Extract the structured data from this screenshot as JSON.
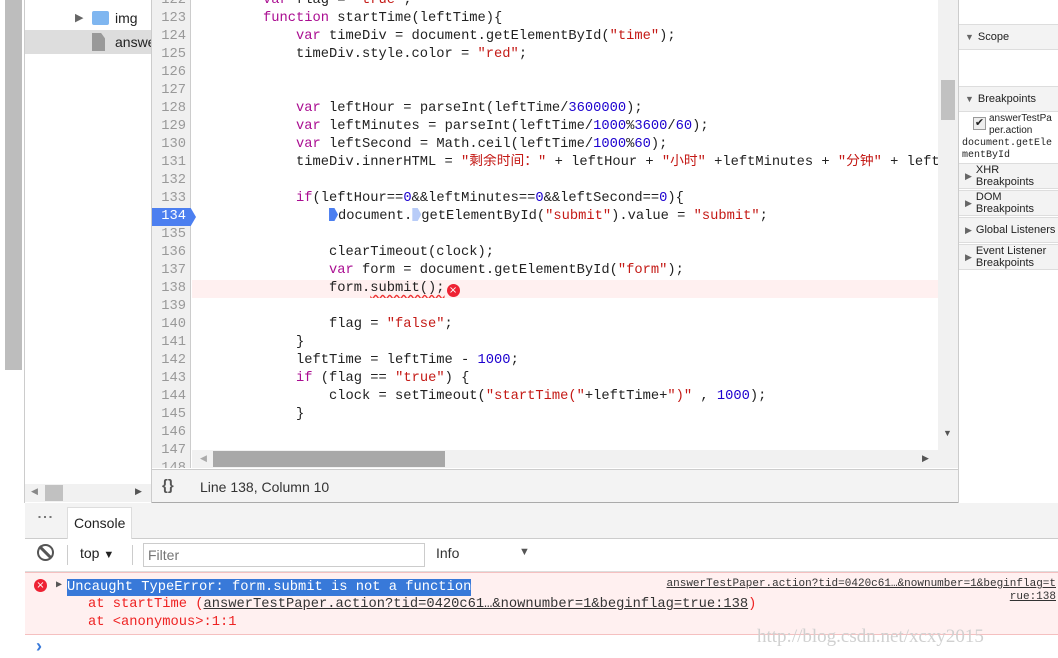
{
  "navigator": {
    "items": [
      {
        "label": "img",
        "type": "folder"
      },
      {
        "label": "answerTestPaper.action",
        "type": "file"
      }
    ]
  },
  "editor": {
    "first_line": 122,
    "breakpoint_line": 134,
    "error_line": 138,
    "lines": [
      {
        "n": 122,
        "t": [
          [
            "",
            "        "
          ],
          [
            "kw",
            "var"
          ],
          [
            "",
            " flag = "
          ],
          [
            "str",
            "\"true\""
          ],
          [
            "",
            ";"
          ]
        ]
      },
      {
        "n": 123,
        "t": [
          [
            "",
            "        "
          ],
          [
            "kw",
            "function"
          ],
          [
            "",
            " startTime(leftTime){"
          ]
        ]
      },
      {
        "n": 124,
        "t": [
          [
            "",
            "            "
          ],
          [
            "kw",
            "var"
          ],
          [
            "",
            " timeDiv = document.getElementById("
          ],
          [
            "str",
            "\"time\""
          ],
          [
            "",
            ");"
          ]
        ]
      },
      {
        "n": 125,
        "t": [
          [
            "",
            "            timeDiv.style.color = "
          ],
          [
            "str",
            "\"red\""
          ],
          [
            "",
            ";"
          ]
        ]
      },
      {
        "n": 126,
        "t": []
      },
      {
        "n": 127,
        "t": []
      },
      {
        "n": 128,
        "t": [
          [
            "",
            "            "
          ],
          [
            "kw",
            "var"
          ],
          [
            "",
            " leftHour = parseInt(leftTime/"
          ],
          [
            "num",
            "3600000"
          ],
          [
            "",
            ");"
          ]
        ]
      },
      {
        "n": 129,
        "t": [
          [
            "",
            "            "
          ],
          [
            "kw",
            "var"
          ],
          [
            "",
            " leftMinutes = parseInt(leftTime/"
          ],
          [
            "num",
            "1000"
          ],
          [
            "",
            "%"
          ],
          [
            "num",
            "3600"
          ],
          [
            "",
            "/"
          ],
          [
            "num",
            "60"
          ],
          [
            "",
            ");"
          ]
        ]
      },
      {
        "n": 130,
        "t": [
          [
            "",
            "            "
          ],
          [
            "kw",
            "var"
          ],
          [
            "",
            " leftSecond = Math.ceil(leftTime/"
          ],
          [
            "num",
            "1000"
          ],
          [
            "",
            "%"
          ],
          [
            "num",
            "60"
          ],
          [
            "",
            ");"
          ]
        ]
      },
      {
        "n": 131,
        "t": [
          [
            "",
            "            timeDiv.innerHTML = "
          ],
          [
            "str",
            "\"剩余时间：\""
          ],
          [
            "",
            " + leftHour + "
          ],
          [
            "str",
            "\"小时\""
          ],
          [
            "",
            " +leftMinutes + "
          ],
          [
            "str",
            "\"分钟\""
          ],
          [
            "",
            " + leftSecond"
          ]
        ]
      },
      {
        "n": 132,
        "t": []
      },
      {
        "n": 133,
        "t": [
          [
            "",
            "            "
          ],
          [
            "kw",
            "if"
          ],
          [
            "",
            "(leftHour=="
          ],
          [
            "num",
            "0"
          ],
          [
            "",
            "&&leftMinutes=="
          ],
          [
            "num",
            "0"
          ],
          [
            "",
            "&&leftSecond=="
          ],
          [
            "num",
            "0"
          ],
          [
            "",
            "){"
          ]
        ]
      },
      {
        "n": 134,
        "t": [
          [
            "",
            "                "
          ],
          [
            "bp",
            ""
          ],
          [
            "",
            "document."
          ],
          [
            "bpl",
            ""
          ],
          [
            "",
            "getElementById("
          ],
          [
            "str",
            "\"submit\""
          ],
          [
            "",
            ").value = "
          ],
          [
            "str",
            "\"submit\""
          ],
          [
            "",
            ";"
          ]
        ]
      },
      {
        "n": 135,
        "t": []
      },
      {
        "n": 136,
        "t": [
          [
            "",
            "                clearTimeout(clock);"
          ]
        ]
      },
      {
        "n": 137,
        "t": [
          [
            "",
            "                "
          ],
          [
            "kw",
            "var"
          ],
          [
            "",
            " form = document.getElementById("
          ],
          [
            "str",
            "\"form\""
          ],
          [
            "",
            ");"
          ]
        ]
      },
      {
        "n": 138,
        "t": [
          [
            "",
            "                form."
          ],
          [
            "squig",
            "submit();"
          ],
          [
            "errbadge",
            "×"
          ]
        ]
      },
      {
        "n": 139,
        "t": []
      },
      {
        "n": 140,
        "t": [
          [
            "",
            "                flag = "
          ],
          [
            "str",
            "\"false\""
          ],
          [
            "",
            ";"
          ]
        ]
      },
      {
        "n": 141,
        "t": [
          [
            "",
            "            }"
          ]
        ]
      },
      {
        "n": 142,
        "t": [
          [
            "",
            "            leftTime = leftTime - "
          ],
          [
            "num",
            "1000"
          ],
          [
            "",
            ";"
          ]
        ]
      },
      {
        "n": 143,
        "t": [
          [
            "",
            "            "
          ],
          [
            "kw",
            "if"
          ],
          [
            "",
            " (flag == "
          ],
          [
            "str",
            "\"true\""
          ],
          [
            "",
            ") {"
          ]
        ]
      },
      {
        "n": 144,
        "t": [
          [
            "",
            "                clock = setTimeout("
          ],
          [
            "str",
            "\"startTime(\""
          ],
          [
            "",
            "+leftTime+"
          ],
          [
            "str",
            "\")\""
          ],
          [
            "",
            " , "
          ],
          [
            "num",
            "1000"
          ],
          [
            "",
            ");"
          ]
        ]
      },
      {
        "n": 145,
        "t": [
          [
            "",
            "            }"
          ]
        ]
      },
      {
        "n": 146,
        "t": []
      },
      {
        "n": 147,
        "t": []
      },
      {
        "n": 148,
        "t": []
      }
    ]
  },
  "status": {
    "format_icon": "{}",
    "position": "Line 138, Column 10"
  },
  "sidebar": {
    "scope": "Scope",
    "breakpoints": "Breakpoints",
    "breakpoint_file": "answerTestPaper.action",
    "breakpoint_code": "document.getElementById",
    "breakpoint_checked": true,
    "xhr": "XHR Breakpoints",
    "dom": "DOM Breakpoints",
    "global": "Global Listeners",
    "event": "Event Listener Breakpoints"
  },
  "drawer": {
    "tab": "Console"
  },
  "console_toolbar": {
    "context": "top",
    "filter_placeholder": "Filter",
    "level": "Info"
  },
  "console": {
    "error_message": "Uncaught TypeError: form.submit is not a function",
    "source_link": "answerTestPaper.action?tid=0420c61…&nownumber=1&beginflag=true:138",
    "stack_1_prefix": "at startTime (",
    "stack_1_link": "answerTestPaper.action?tid=0420c61…&nownumber=1&beginflag=true:138",
    "stack_1_suffix": ")",
    "stack_2": "at <anonymous>:1:1",
    "prompt": "›"
  },
  "watermark": "http://blog.csdn.net/xcxy2015",
  "colors": {
    "keyword": "#aa0d91",
    "string": "#c41a16",
    "number": "#1c00cf",
    "breakpoint": "#4c7ff0",
    "error_bg": "#fff0f0",
    "selection": "#3879d9"
  }
}
